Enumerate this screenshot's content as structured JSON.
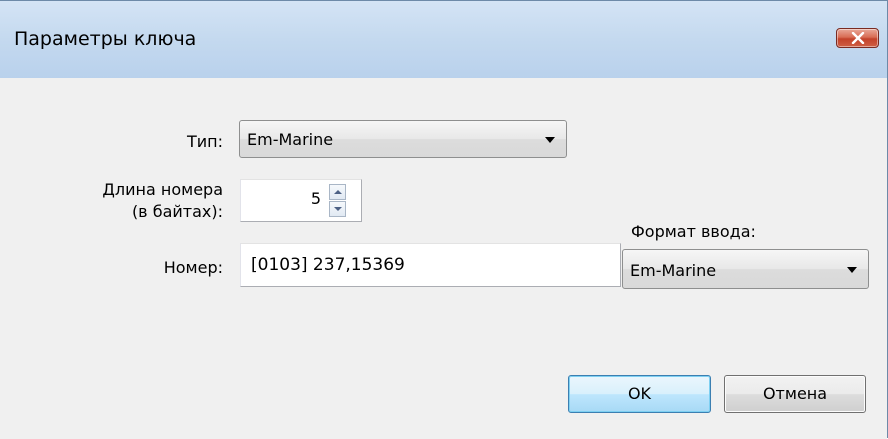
{
  "window": {
    "title": "Параметры ключа",
    "close_icon": "close-x-icon"
  },
  "form": {
    "type_label": "Тип:",
    "type_value": "Em-Marine",
    "length_label_line1": "Длина номера",
    "length_label_line2": "(в байтах):",
    "length_value": "5",
    "number_label": "Номер:",
    "number_value": "[0103] 237,15369",
    "input_format_label": "Формат ввода:",
    "input_format_value": "Em-Marine"
  },
  "buttons": {
    "ok_label": "OK",
    "cancel_label": "Отмена"
  },
  "colors": {
    "close_button": "#c3422a",
    "default_button_border": "#3c7fb1",
    "titlebar": "#c4d9ef"
  }
}
